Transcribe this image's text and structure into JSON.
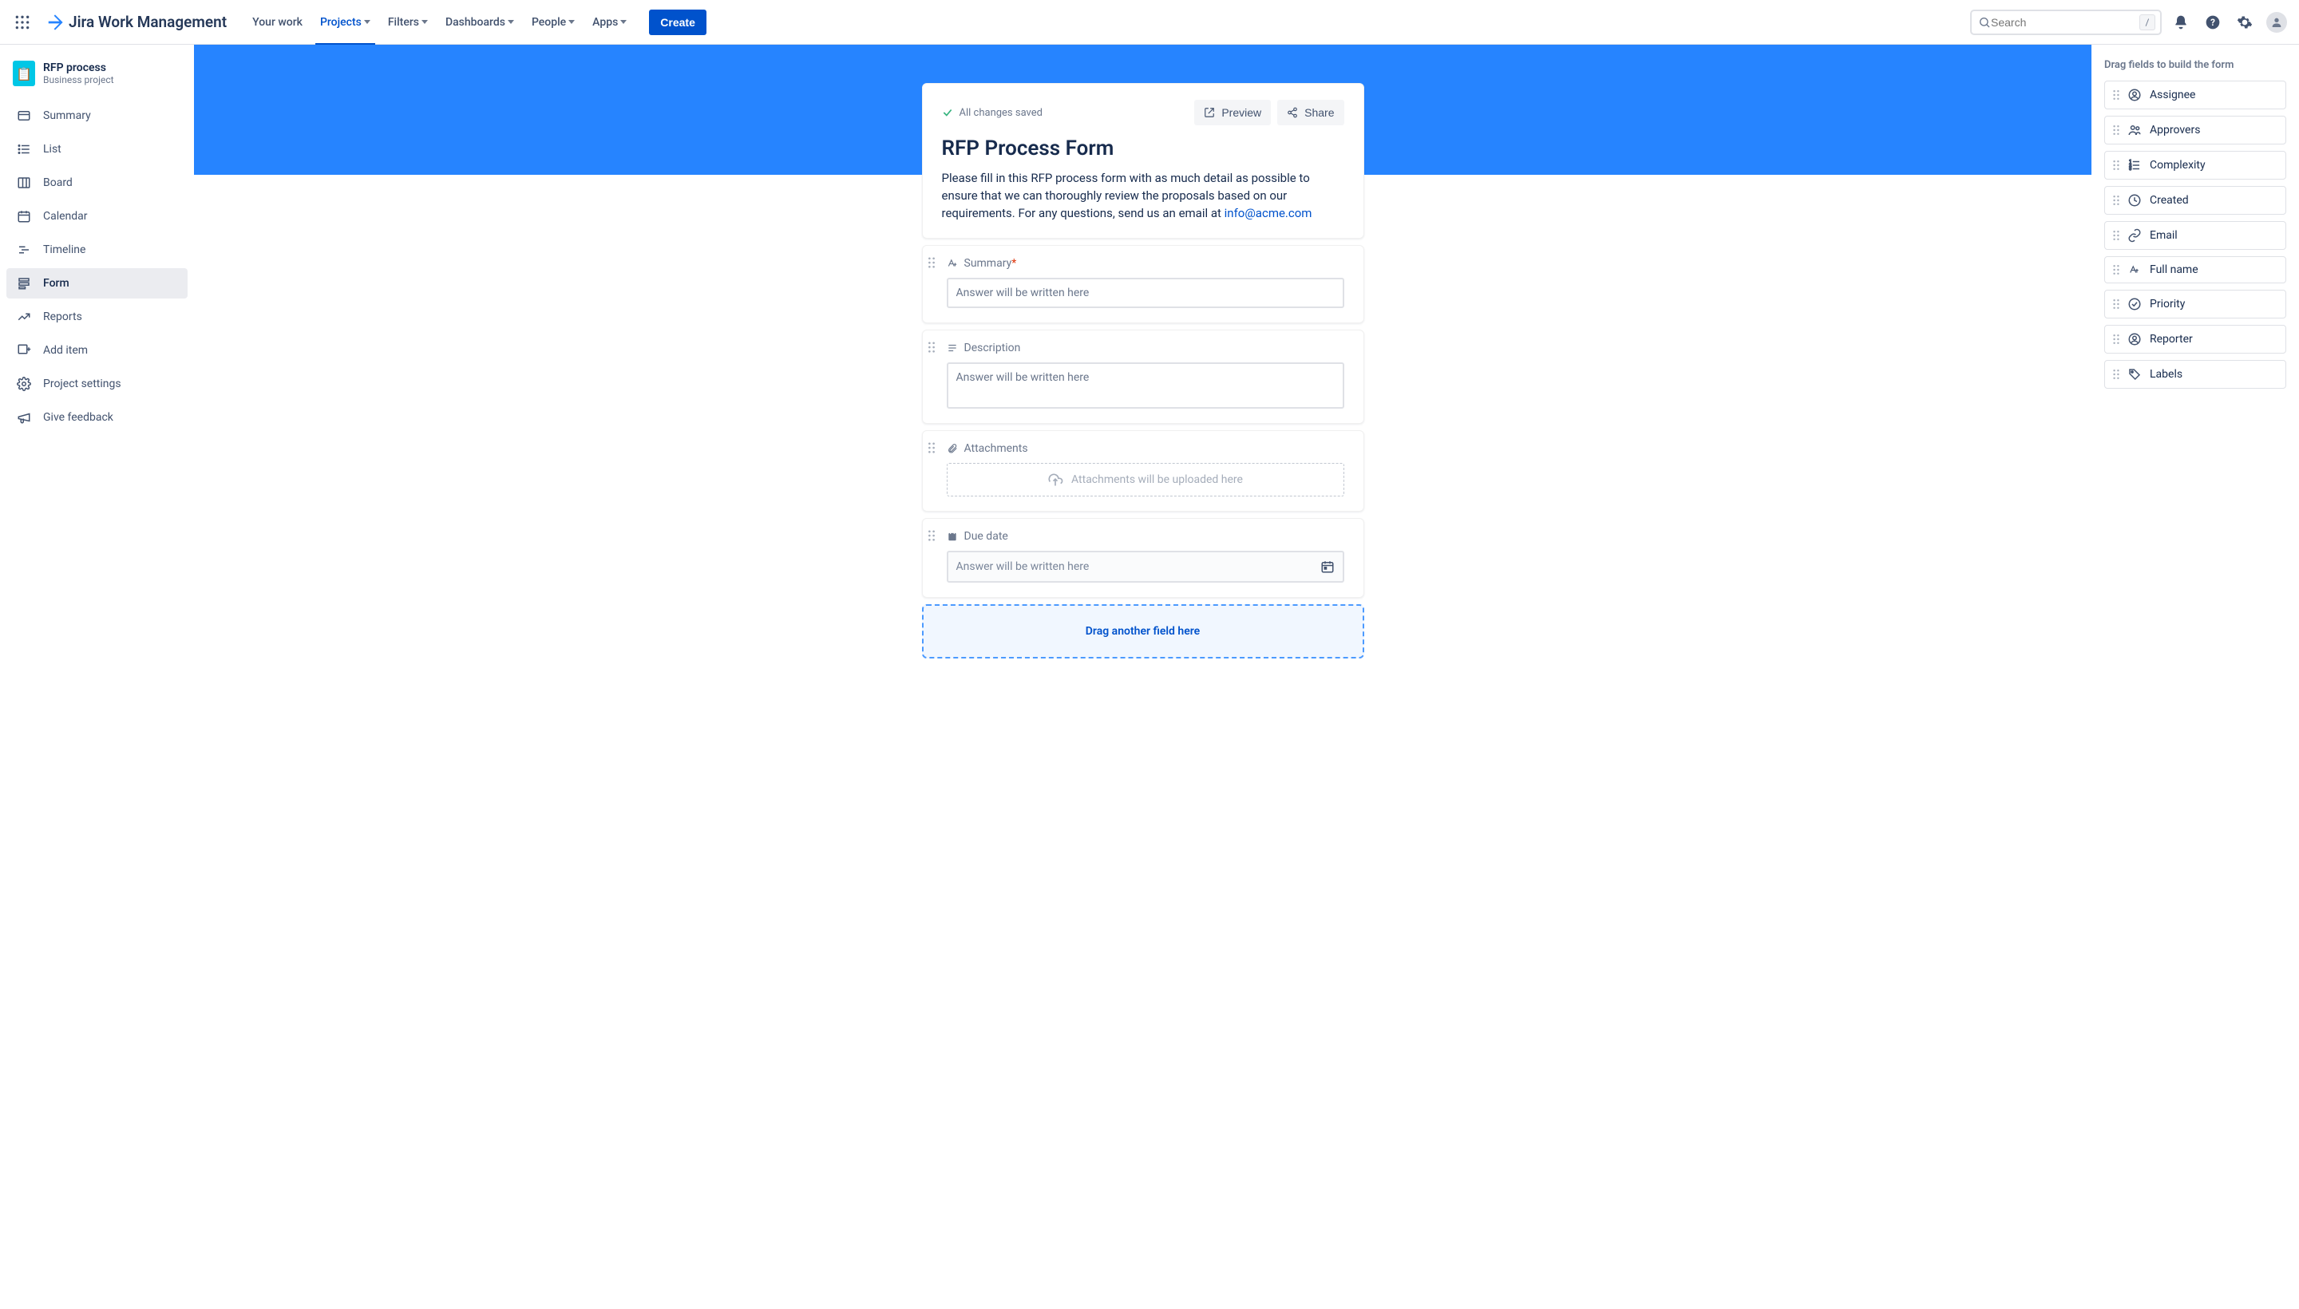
{
  "nav": {
    "product": "Jira Work Management",
    "items": [
      "Your work",
      "Projects",
      "Filters",
      "Dashboards",
      "People",
      "Apps"
    ],
    "activeIndex": 1,
    "createLabel": "Create",
    "searchPlaceholder": "Search",
    "slashHint": "/"
  },
  "project": {
    "name": "RFP process",
    "type": "Business project"
  },
  "sidebar": {
    "items": [
      "Summary",
      "List",
      "Board",
      "Calendar",
      "Timeline",
      "Form",
      "Reports",
      "Add item",
      "Project settings",
      "Give feedback"
    ],
    "activeIndex": 5
  },
  "formHeader": {
    "savedLabel": "All changes saved",
    "previewLabel": "Preview",
    "shareLabel": "Share",
    "title": "RFP Process Form",
    "descPrefix": "Please fill in this RFP process form with as much detail as possible to ensure that we can thoroughly review the proposals based on our requirements. For any questions, send us an email at ",
    "descEmail": "info@acme.com"
  },
  "fields": {
    "summary": {
      "label": "Summary",
      "required": true,
      "placeholder": "Answer will be written here"
    },
    "description": {
      "label": "Description",
      "placeholder": "Answer will be written here"
    },
    "attachments": {
      "label": "Attachments",
      "placeholder": "Attachments will be uploaded here"
    },
    "dueDate": {
      "label": "Due date",
      "placeholder": "Answer will be written here"
    }
  },
  "dropZoneLabel": "Drag another field here",
  "palette": {
    "title": "Drag fields to build the form",
    "items": [
      "Assignee",
      "Approvers",
      "Complexity",
      "Created",
      "Email",
      "Full name",
      "Priority",
      "Reporter",
      "Labels"
    ]
  }
}
